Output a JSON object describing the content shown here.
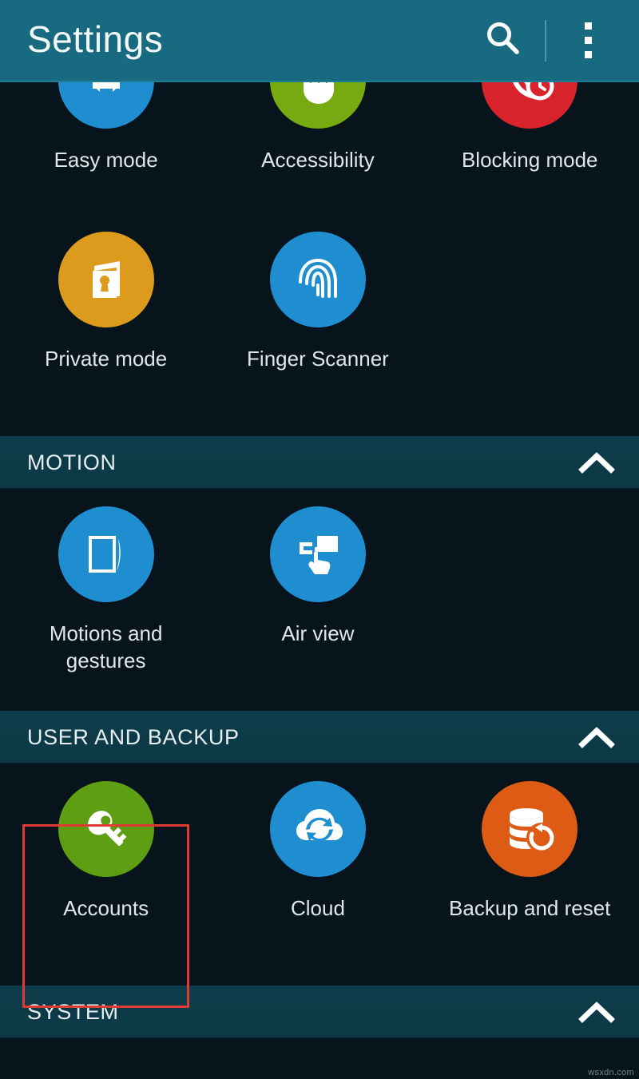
{
  "app": {
    "title": "Settings",
    "watermark": "wsxdn.com"
  },
  "actionbar": {
    "title": "Settings",
    "search_icon": "search-icon",
    "overflow_icon": "more-vertical-icon"
  },
  "colors": {
    "actionbar_bg": "#176a80",
    "page_bg": "#07141b",
    "section_bg": "#0d3a47",
    "label_text": "#dfe7ea",
    "highlight_border": "#e03a34",
    "icon_blue": "#1f8ed1",
    "icon_green": "#77a910",
    "icon_red": "#d9232c",
    "icon_amber": "#dd9b1e",
    "icon_accounts_green": "#5d9e12",
    "icon_orange": "#dd5b14"
  },
  "sections": [
    {
      "id": "personalization-continued",
      "header": null,
      "items": [
        {
          "label": "Easy mode",
          "icon": "easy-mode-icon",
          "color": "#1f8ed1",
          "clipped": true
        },
        {
          "label": "Accessibility",
          "icon": "accessibility-hand-icon",
          "color": "#77a910",
          "clipped": true
        },
        {
          "label": "Blocking mode",
          "icon": "blocking-mode-icon",
          "color": "#d9232c",
          "clipped": true
        }
      ]
    },
    {
      "id": "privacy",
      "header": null,
      "items": [
        {
          "label": "Private mode",
          "icon": "private-mode-icon",
          "color": "#dd9b1e"
        },
        {
          "label": "Finger Scanner",
          "icon": "fingerprint-icon",
          "color": "#1f8ed1"
        }
      ]
    },
    {
      "id": "motion",
      "header": "MOTION",
      "collapse_icon": "chevron-up-icon",
      "items": [
        {
          "label": "Motions and gestures",
          "icon": "motions-gestures-icon",
          "color": "#1f8ed1"
        },
        {
          "label": "Air view",
          "icon": "air-view-icon",
          "color": "#1f8ed1"
        }
      ]
    },
    {
      "id": "user-and-backup",
      "header": "USER AND BACKUP",
      "collapse_icon": "chevron-up-icon",
      "items": [
        {
          "label": "Accounts",
          "icon": "key-icon",
          "color": "#5d9e12",
          "selected": true
        },
        {
          "label": "Cloud",
          "icon": "cloud-sync-icon",
          "color": "#1f8ed1"
        },
        {
          "label": "Backup and reset",
          "icon": "backup-reset-icon",
          "color": "#dd5b14"
        }
      ]
    },
    {
      "id": "system",
      "header": "SYSTEM",
      "collapse_icon": "chevron-up-icon",
      "items": []
    }
  ],
  "labels": {
    "easy_mode": "Easy mode",
    "accessibility": "Accessibility",
    "blocking_mode": "Blocking mode",
    "private_mode": "Private mode",
    "finger_scanner": "Finger Scanner",
    "motion_header": "MOTION",
    "motions_and_gestures": "Motions and gestures",
    "air_view": "Air view",
    "user_and_backup_header": "USER AND BACKUP",
    "accounts": "Accounts",
    "cloud": "Cloud",
    "backup_and_reset": "Backup and reset",
    "system_header": "SYSTEM"
  }
}
